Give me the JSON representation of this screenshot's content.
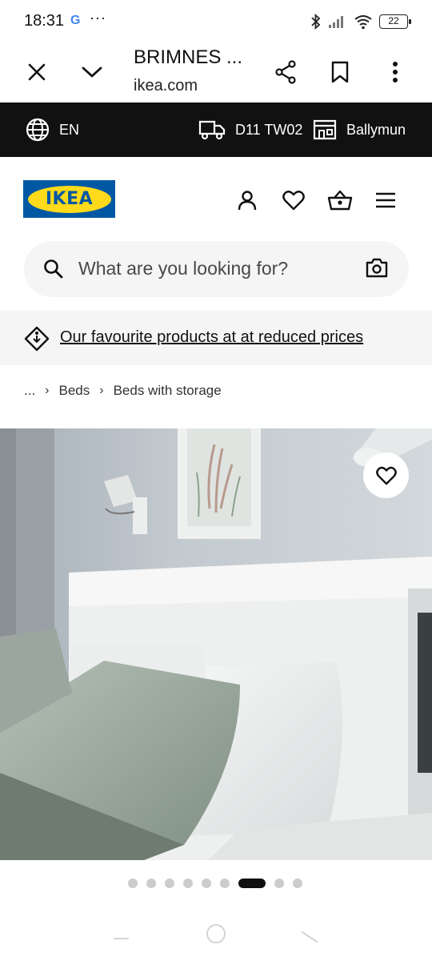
{
  "status_bar": {
    "time": "18:31",
    "google_letter": "G",
    "more": "···",
    "battery": "22"
  },
  "browser": {
    "title": "BRIMNES ...",
    "url": "ikea.com",
    "icons": [
      "close-icon",
      "chevron-down-icon",
      "share-icon",
      "bookmark-icon",
      "more-vertical-icon"
    ]
  },
  "store_strip": {
    "language": "EN",
    "delivery_code": "D11 TW02",
    "store": "Ballymun"
  },
  "header": {
    "logo_text": "IKEA",
    "icons": [
      "profile-icon",
      "heart-icon",
      "basket-icon",
      "menu-icon"
    ]
  },
  "search": {
    "placeholder": "What are you looking for?"
  },
  "promo": {
    "text": "Our favourite products at at reduced prices"
  },
  "breadcrumb": {
    "ellipsis": "...",
    "items": [
      "Beds",
      "Beds with storage"
    ]
  },
  "gallery": {
    "dot_count": 9,
    "active_index": 6
  },
  "colors": {
    "ikea_blue": "#0058A3",
    "ikea_yellow": "#FFDA1A",
    "strip_bg": "#111111",
    "light_bg": "#F5F5F5"
  }
}
